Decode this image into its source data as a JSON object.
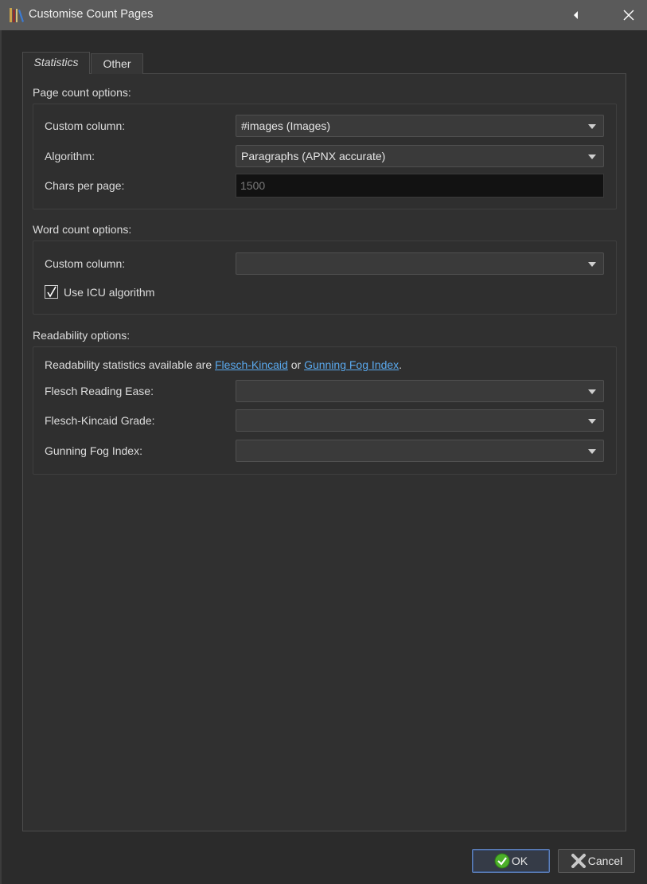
{
  "window": {
    "title": "Customise Count Pages"
  },
  "tabs": [
    {
      "label": "Statistics",
      "active": true
    },
    {
      "label": "Other",
      "active": false
    }
  ],
  "page_count": {
    "section_title": "Page count options:",
    "custom_column_label": "Custom column:",
    "custom_column_value": "#images (Images)",
    "algorithm_label": "Algorithm:",
    "algorithm_value": "Paragraphs (APNX accurate)",
    "chars_per_page_label": "Chars per page:",
    "chars_per_page_value": "1500"
  },
  "word_count": {
    "section_title": "Word count options:",
    "custom_column_label": "Custom column:",
    "custom_column_value": "",
    "icu_label": "Use ICU algorithm",
    "icu_checked": true
  },
  "readability": {
    "section_title": "Readability options:",
    "intro_text": "Readability statistics available are",
    "link1": "Flesch-Kincaid",
    "or_text": "or",
    "link2": "Gunning Fog Index",
    "period": ".",
    "flesch_ease_label": "Flesch Reading Ease:",
    "flesch_ease_value": "",
    "flesch_grade_label": "Flesch-Kincaid Grade:",
    "flesch_grade_value": "",
    "gunning_label": "Gunning Fog Index:",
    "gunning_value": ""
  },
  "buttons": {
    "ok": "OK",
    "cancel": "Cancel"
  },
  "icons": {
    "app": "books-icon",
    "back": "chevron-left-icon",
    "close": "close-icon",
    "ok": "check-circle-icon",
    "cancel": "cross-icon"
  },
  "colors": {
    "link": "#5aa9ee",
    "ok_check": "#4caf2a",
    "titlebar": "#5a5a5a"
  }
}
